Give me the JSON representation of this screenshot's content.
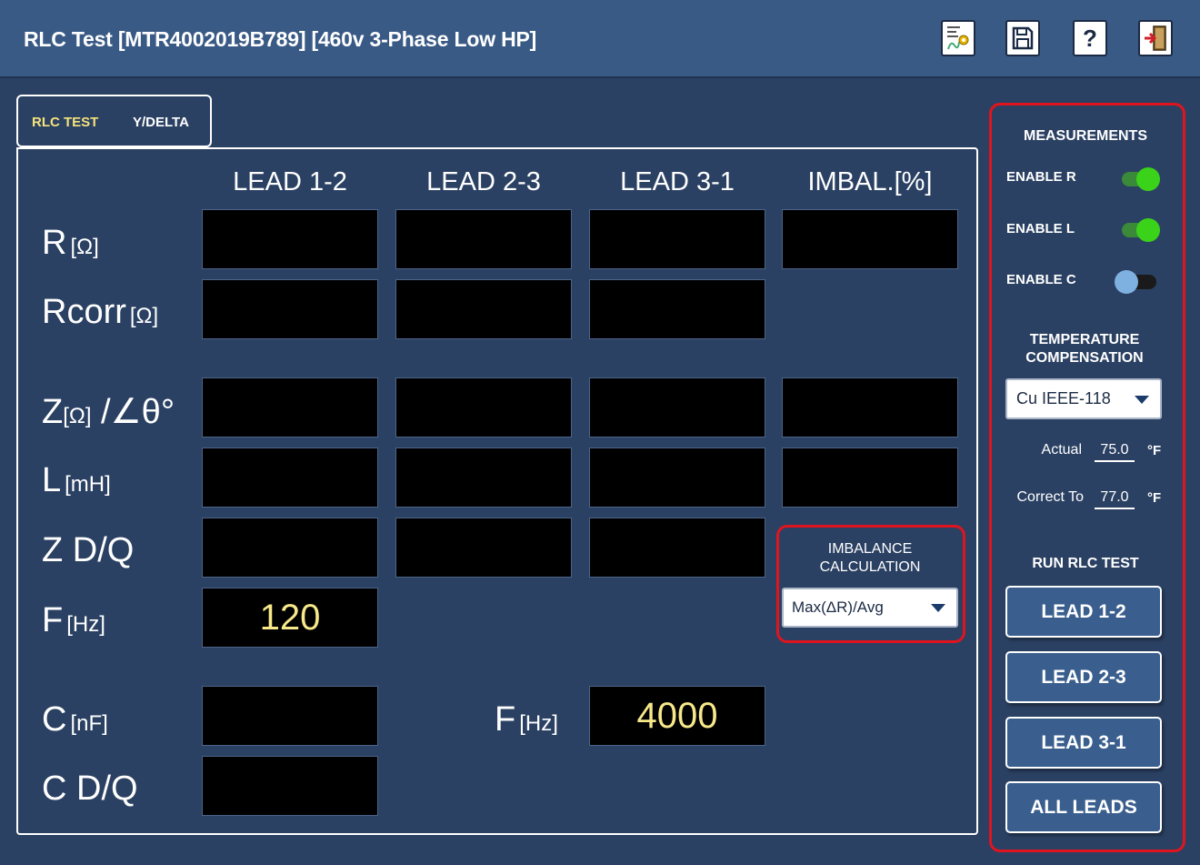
{
  "app": {
    "title": "RLC Test [MTR4002019B789] [460v 3-Phase Low HP]",
    "toolbar": [
      "settings-icon",
      "save-icon",
      "help-icon",
      "exit-icon"
    ],
    "help_glyph": "?"
  },
  "tabs": [
    {
      "label": "RLC TEST",
      "active": true
    },
    {
      "label": "Y/DELTA",
      "active": false
    }
  ],
  "table": {
    "columns": [
      "LEAD 1-2",
      "LEAD 2-3",
      "LEAD 3-1",
      "IMBAL.[%]"
    ],
    "rows": {
      "r": {
        "label": "R",
        "unit": "[Ω]"
      },
      "rcorr": {
        "label": "Rcorr",
        "unit": "[Ω]"
      },
      "z": {
        "label": "Z",
        "unit": "[Ω]",
        "suffix": " /∠θ°"
      },
      "l": {
        "label": "L",
        "unit": "[mH]"
      },
      "zdq": {
        "label": "Z D/Q",
        "unit": ""
      },
      "f": {
        "label": "F",
        "unit": "[Hz]",
        "value": "120"
      },
      "c": {
        "label": "C",
        "unit": "[nF]"
      },
      "cdq": {
        "label": "C D/Q",
        "unit": ""
      }
    },
    "c_freq": {
      "label": "F",
      "unit": "[Hz]",
      "value": "4000"
    }
  },
  "imbalance": {
    "title": "IMBALANCE CALCULATION",
    "selected": "Max(ΔR)/Avg"
  },
  "sidebar": {
    "measurements_title": "MEASUREMENTS",
    "toggles": [
      {
        "label": "ENABLE R",
        "on": true
      },
      {
        "label": "ENABLE L",
        "on": true
      },
      {
        "label": "ENABLE C",
        "on": false
      }
    ],
    "temp_title": "TEMPERATURE COMPENSATION",
    "temp_mode": "Cu IEEE-118",
    "actual": {
      "label": "Actual",
      "value": "75.0",
      "unit": "°F"
    },
    "correct_to": {
      "label": "Correct To",
      "value": "77.0",
      "unit": "°F"
    },
    "run_title": "RUN RLC TEST",
    "run_buttons": [
      "LEAD 1-2",
      "LEAD 2-3",
      "LEAD 3-1",
      "ALL LEADS"
    ]
  },
  "colors": {
    "background": "#2b4163",
    "titlebar": "#3a5a86",
    "highlight": "#e0141e",
    "value_text": "#f7e88a",
    "toggle_on": "#3bd21a",
    "toggle_off": "#7eb0e0"
  }
}
